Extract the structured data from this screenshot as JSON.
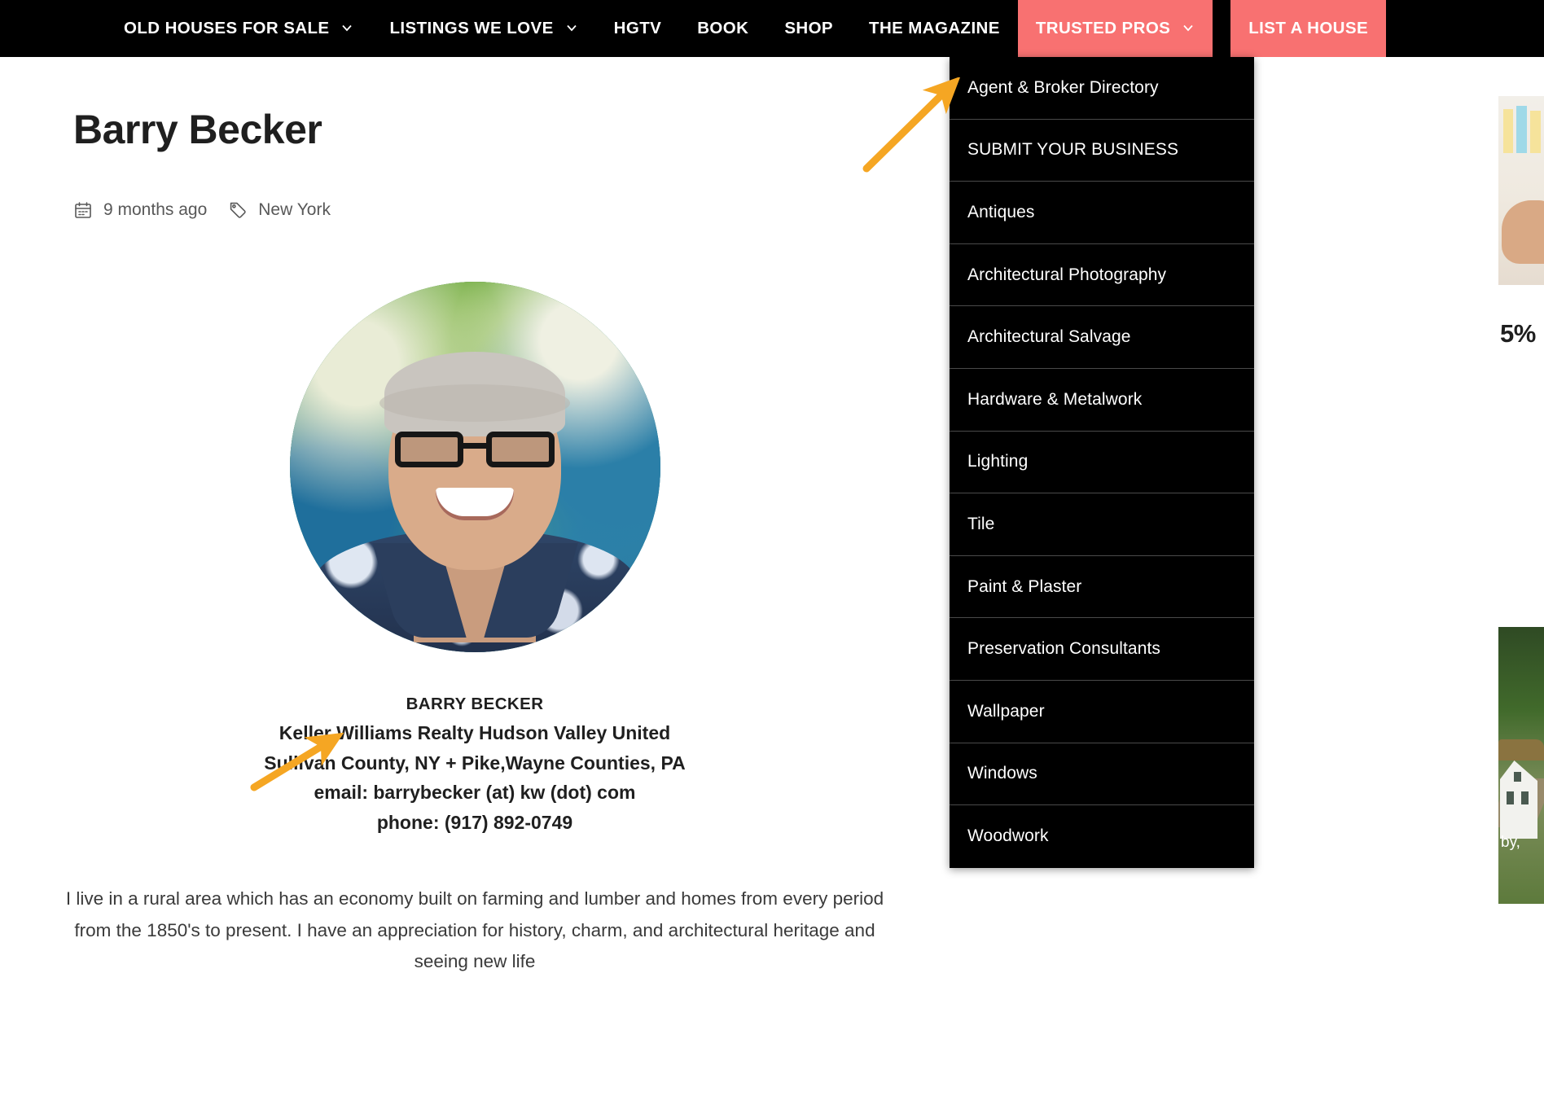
{
  "nav": {
    "items": [
      {
        "label": "OLD HOUSES FOR SALE",
        "caret": true,
        "accent": false,
        "icon": "chevron-down-icon"
      },
      {
        "label": "LISTINGS WE LOVE",
        "caret": true,
        "accent": false,
        "icon": "chevron-down-icon"
      },
      {
        "label": "HGTV",
        "caret": false,
        "accent": false,
        "icon": ""
      },
      {
        "label": "BOOK",
        "caret": false,
        "accent": false,
        "icon": ""
      },
      {
        "label": "SHOP",
        "caret": false,
        "accent": false,
        "icon": ""
      },
      {
        "label": "THE MAGAZINE",
        "caret": false,
        "accent": false,
        "icon": ""
      },
      {
        "label": "TRUSTED PROS",
        "caret": true,
        "accent": true,
        "icon": "chevron-down-icon"
      },
      {
        "label": "LIST A HOUSE",
        "caret": false,
        "accent": true,
        "icon": ""
      }
    ],
    "accent_color": "#F87171",
    "background_color": "#000000"
  },
  "dropdown": {
    "parent": "TRUSTED PROS",
    "open": true,
    "background_color": "#000000",
    "items": [
      {
        "label": "Agent & Broker Directory"
      },
      {
        "label": "SUBMIT YOUR BUSINESS"
      },
      {
        "label": "Antiques"
      },
      {
        "label": "Architectural Photography"
      },
      {
        "label": "Architectural Salvage"
      },
      {
        "label": "Hardware & Metalwork"
      },
      {
        "label": "Lighting"
      },
      {
        "label": "Tile"
      },
      {
        "label": "Paint & Plaster"
      },
      {
        "label": "Preservation Consultants"
      },
      {
        "label": "Wallpaper"
      },
      {
        "label": "Windows"
      },
      {
        "label": "Woodwork"
      }
    ]
  },
  "article": {
    "title": "Barry Becker",
    "meta": {
      "date_icon": "calendar-icon",
      "date": "9 months ago",
      "tag_icon": "tag-icon",
      "tag": "New York"
    },
    "avatar_alt": "Barry Becker headshot",
    "contact": {
      "name": "BARRY BECKER",
      "company": "Keller Williams Realty Hudson Valley United",
      "area": "Sullivan County, NY + Pike,Wayne Counties, PA",
      "email": "email: barrybecker (at) kw (dot) com",
      "phone": "phone: (917) 892-0749"
    },
    "body": "I live in a rural area which has an economy built on farming and lumber and homes from every period from the 1850's to present. I have an appreciation for history, charm, and architectural heritage and seeing new life"
  },
  "sidebar_peek": {
    "percent_fragment": "5%",
    "caption_fragment": "by,"
  },
  "annotations": {
    "color": "#F5A623",
    "arrows": [
      {
        "name": "arrow-to-agent-broker-directory",
        "points_to": "Agent & Broker Directory"
      },
      {
        "name": "arrow-to-company-name",
        "points_to": "Keller Williams Realty Hudson Valley United"
      }
    ]
  }
}
